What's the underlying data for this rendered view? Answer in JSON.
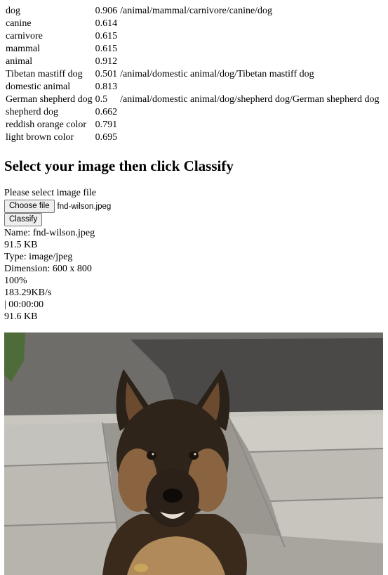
{
  "results": [
    {
      "label": "dog",
      "score": "0.906",
      "path": "/animal/mammal/carnivore/canine/dog"
    },
    {
      "label": "canine",
      "score": "0.614",
      "path": ""
    },
    {
      "label": "carnivore",
      "score": "0.615",
      "path": ""
    },
    {
      "label": "mammal",
      "score": "0.615",
      "path": ""
    },
    {
      "label": "animal",
      "score": "0.912",
      "path": ""
    },
    {
      "label": "Tibetan mastiff dog",
      "score": "0.501",
      "path": "/animal/domestic animal/dog/Tibetan mastiff dog"
    },
    {
      "label": "domestic animal",
      "score": "0.813",
      "path": ""
    },
    {
      "label": "German shepherd dog",
      "score": "0.5",
      "path": "/animal/domestic animal/dog/shepherd dog/German shepherd dog"
    },
    {
      "label": "shepherd dog",
      "score": "0.662",
      "path": ""
    },
    {
      "label": "reddish orange color",
      "score": "0.791",
      "path": ""
    },
    {
      "label": "light brown color",
      "score": "0.695",
      "path": ""
    }
  ],
  "heading": "Select your image then click Classify",
  "form": {
    "prompt": "Please select image file",
    "choose_label": "Choose file",
    "file_name": "fnd-wilson.jpeg",
    "classify_label": "Classify"
  },
  "file_info": {
    "name": "Name: fnd-wilson.jpeg",
    "size": "91.5 KB",
    "type": "Type: image/jpeg",
    "dimension": "Dimension: 600 x 800",
    "progress": "100%",
    "speed": "183.29KB/s",
    "time": "| 00:00:00",
    "uploaded": "91.6 KB"
  },
  "image": {
    "subject": "dog-photo"
  }
}
